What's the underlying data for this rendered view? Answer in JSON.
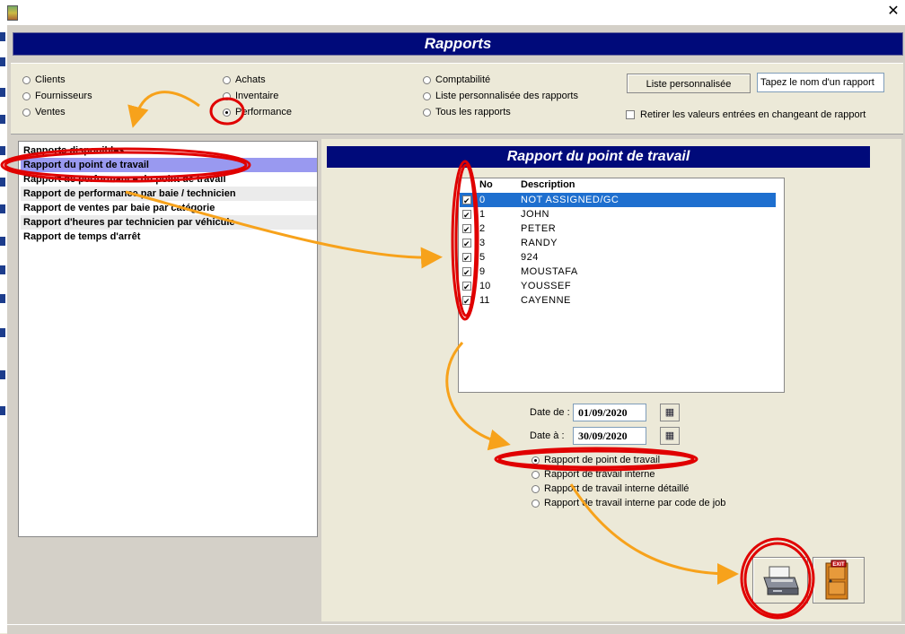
{
  "window": {
    "close_glyph": "✕"
  },
  "banner": {
    "title": "Rapports"
  },
  "categories": {
    "col1": [
      "Clients",
      "Fournisseurs",
      "Ventes"
    ],
    "col2": [
      "Achats",
      "Inventaire",
      "Performance"
    ],
    "col3": [
      "Comptabilité",
      "Liste personnalisée des rapports",
      "Tous les rapports"
    ],
    "selected": "Performance"
  },
  "custom": {
    "button_label": "Liste personnalisée",
    "input_value": "Tapez le nom d'un rapport",
    "checkbox_label": "Retirer les valeurs entrées en changeant de rapport"
  },
  "reports_list": {
    "header": "Rapports disponibles",
    "items": [
      "Rapport du point de travail",
      "Rapport de performance du point de travail",
      "Rapport de performance par baie / technicien",
      "Rapport de ventes par baie par catégorie",
      "Rapport d'heures par technicien par véhicule",
      "Rapport de temps d'arrêt"
    ],
    "selected_index": 0
  },
  "detail": {
    "title": "Rapport du point de travail",
    "columns": {
      "no": "No",
      "description": "Description"
    },
    "rows": [
      {
        "no": "0",
        "description": "NOT ASSIGNED/GC",
        "checked": true
      },
      {
        "no": "1",
        "description": "JOHN",
        "checked": true
      },
      {
        "no": "2",
        "description": "PETER",
        "checked": true
      },
      {
        "no": "3",
        "description": "RANDY",
        "checked": true
      },
      {
        "no": "5",
        "description": "924",
        "checked": true
      },
      {
        "no": "9",
        "description": "MOUSTAFA",
        "checked": true
      },
      {
        "no": "10",
        "description": "YOUSSEF",
        "checked": true
      },
      {
        "no": "11",
        "description": "CAYENNE",
        "checked": true
      }
    ],
    "date_from_label": "Date de :",
    "date_from": "01/09/2020",
    "date_to_label": "Date à :",
    "date_to": "30/09/2020",
    "options": [
      "Rapport de point de travail",
      "Rapport de travail interne",
      "Rapport de travail interne détaillé",
      "Rapport de travail interne par code de job"
    ],
    "selected_option": 0,
    "exit_text": "EXIT"
  },
  "colors": {
    "banner": "#000a7a",
    "selection": "#9999f0",
    "grid_selection": "#1e6fcf",
    "annotation_red": "#e00000",
    "annotation_orange": "#f7a21b"
  }
}
